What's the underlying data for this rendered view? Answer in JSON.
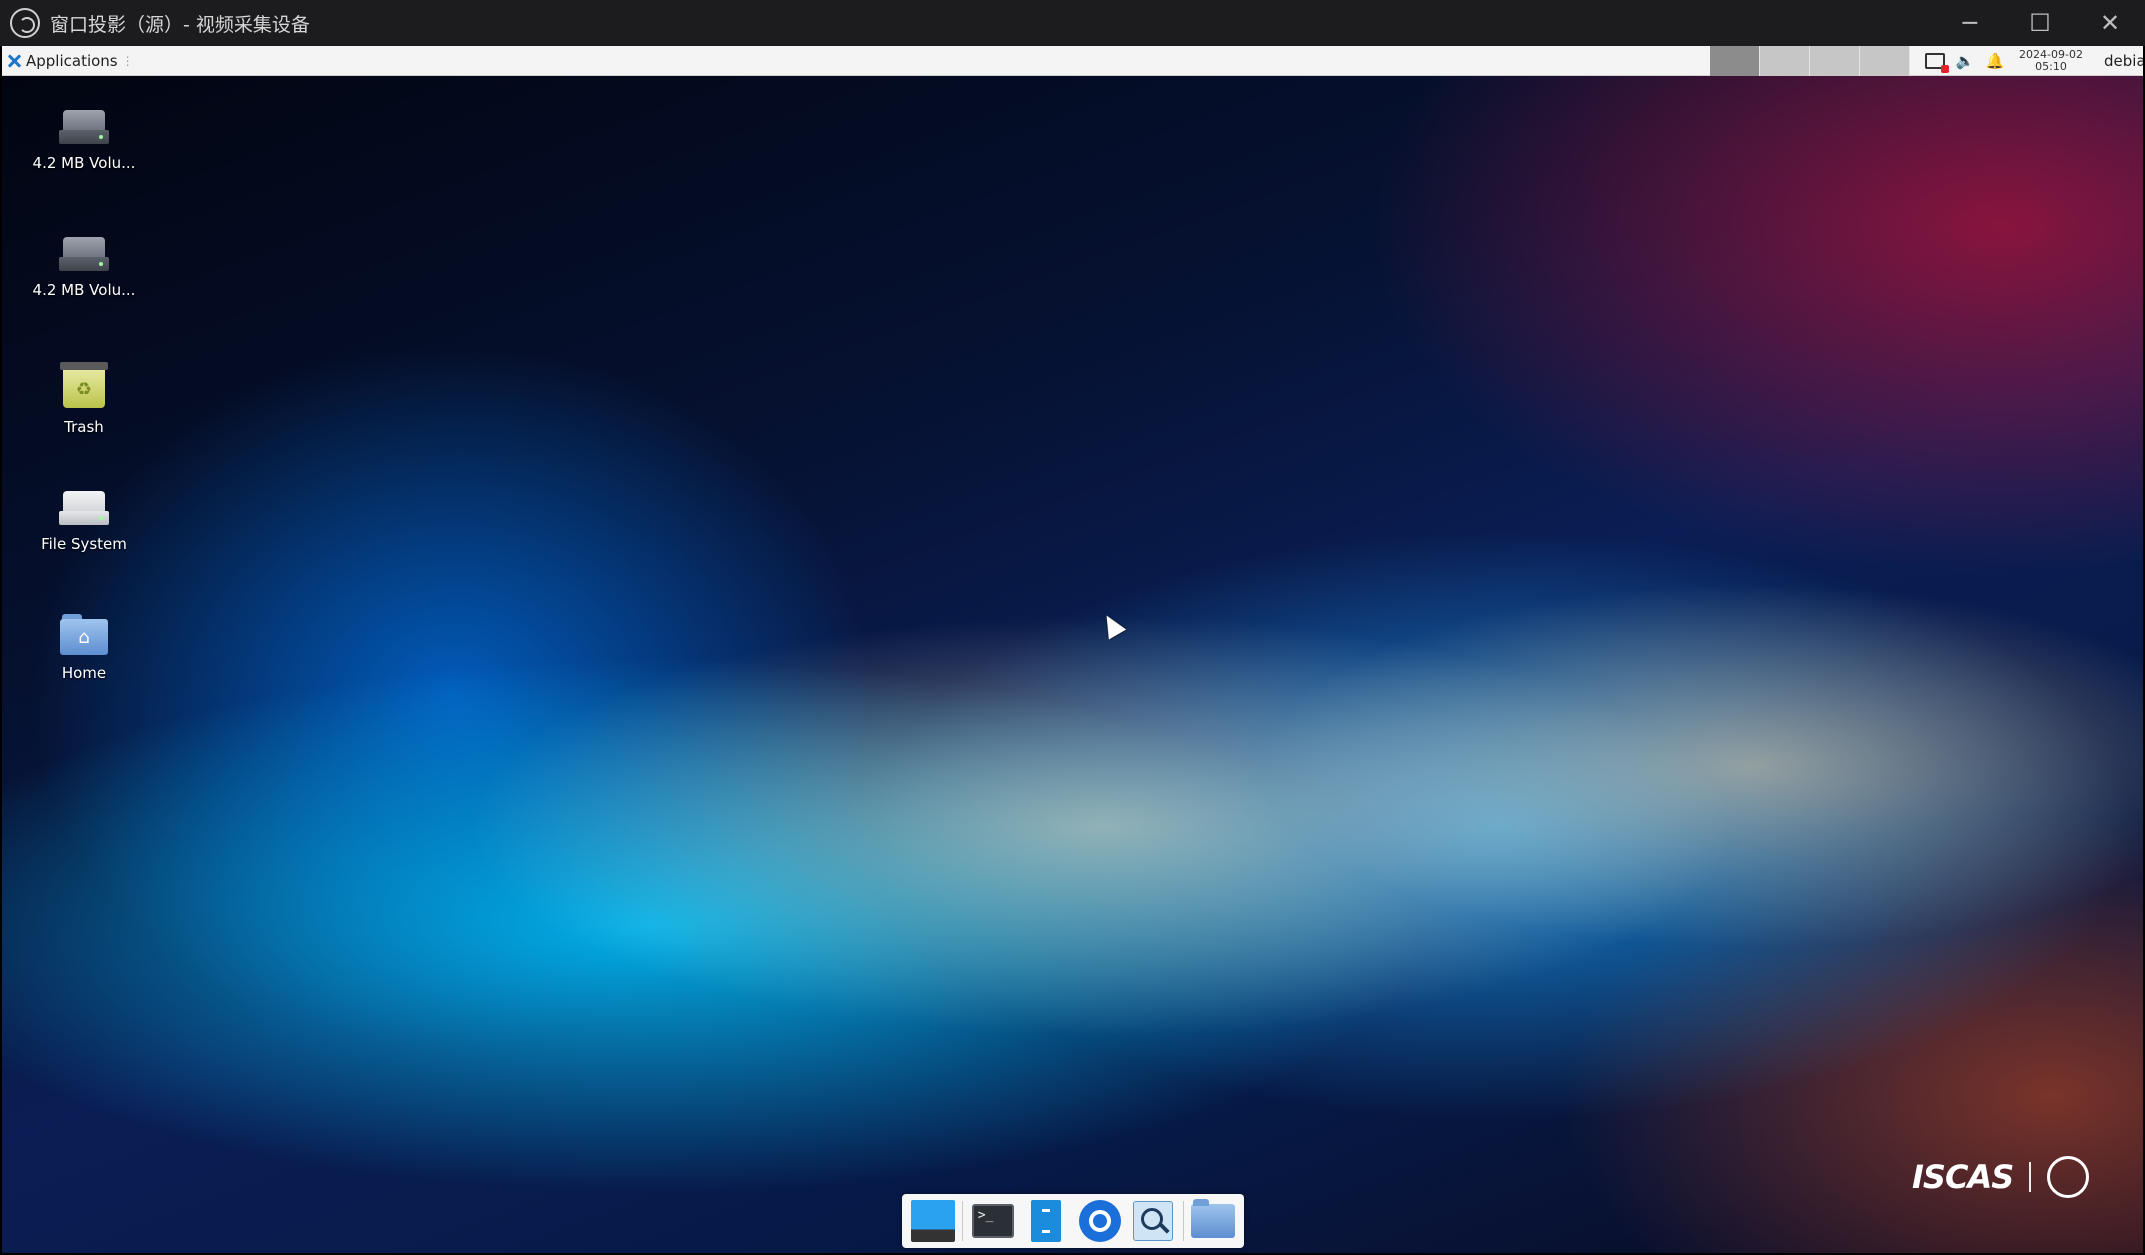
{
  "window": {
    "title": "窗口投影（源）- 视频采集设备",
    "controls": {
      "minimize": "─",
      "maximize": "☐",
      "close": "✕"
    }
  },
  "panel": {
    "app_menu_label": "Applications",
    "workspaces": [
      "1",
      "2",
      "3",
      "4"
    ],
    "active_workspace": 1,
    "clock": {
      "date": "2024-09-02",
      "time": "05:10"
    },
    "user": "debian"
  },
  "desktop_icons": [
    {
      "label": "4.2 MB Volu...",
      "icon": "drive-icon"
    },
    {
      "label": "4.2 MB Volu...",
      "icon": "drive-icon"
    },
    {
      "label": "Trash",
      "icon": "trash-icon"
    },
    {
      "label": "File System",
      "icon": "filesystem-icon"
    },
    {
      "label": "Home",
      "icon": "home-folder-icon"
    }
  ],
  "dock_items": [
    {
      "name": "show-desktop",
      "icon": "desktop-icon"
    },
    {
      "name": "terminal",
      "icon": "terminal-icon"
    },
    {
      "name": "file-manager",
      "icon": "file-manager-icon"
    },
    {
      "name": "web-browser",
      "icon": "browser-icon"
    },
    {
      "name": "app-finder",
      "icon": "search-icon"
    },
    {
      "name": "home-folder",
      "icon": "folder-icon"
    }
  ],
  "watermark": {
    "text": "ISCAS"
  },
  "colors": {
    "panel_bg": "#f4f4f4",
    "accent_blue": "#1e74c7",
    "titlebar_bg": "#1c1c1e"
  }
}
